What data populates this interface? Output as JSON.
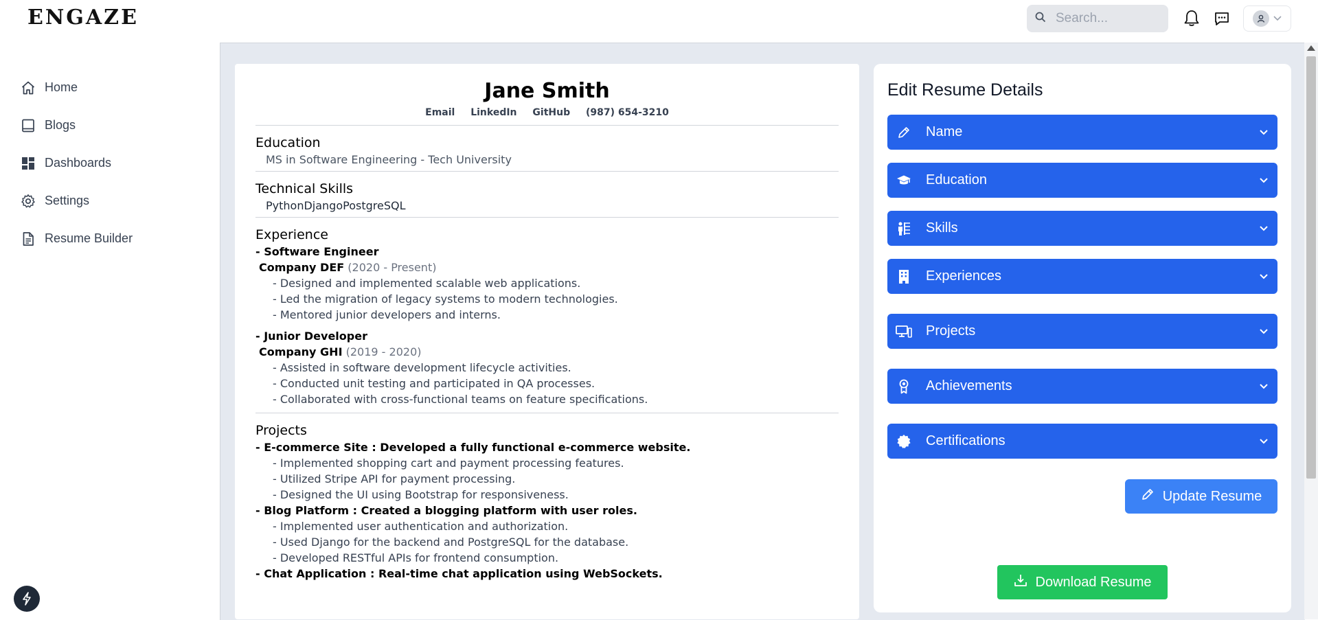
{
  "app": {
    "logo": "ENGAZE"
  },
  "header": {
    "search_placeholder": "Search..."
  },
  "sidebar": {
    "items": [
      {
        "label": "Home",
        "icon": "home-icon"
      },
      {
        "label": "Blogs",
        "icon": "book-icon"
      },
      {
        "label": "Dashboards",
        "icon": "grid-icon"
      },
      {
        "label": "Settings",
        "icon": "gear-icon"
      },
      {
        "label": "Resume Builder",
        "icon": "document-icon"
      }
    ]
  },
  "resume": {
    "name": "Jane Smith",
    "contact": {
      "email": "Email",
      "linkedin": "LinkedIn",
      "github": "GitHub",
      "phone": "(987) 654-3210"
    },
    "education": {
      "heading": "Education",
      "entry": "MS in Software Engineering - Tech University"
    },
    "skills": {
      "heading": "Technical Skills",
      "text": "PythonDjangoPostgreSQL"
    },
    "experience": {
      "heading": "Experience",
      "jobs": [
        {
          "role": "- Software Engineer",
          "company": "Company DEF",
          "years": "(2020 - Present)",
          "bullets": [
            "- Designed and implemented scalable web applications.",
            "- Led the migration of legacy systems to modern technologies.",
            "- Mentored junior developers and interns."
          ]
        },
        {
          "role": "- Junior Developer",
          "company": "Company GHI",
          "years": "(2019 - 2020)",
          "bullets": [
            "- Assisted in software development lifecycle activities.",
            "- Conducted unit testing and participated in QA processes.",
            "- Collaborated with cross-functional teams on feature specifications."
          ]
        }
      ]
    },
    "projects": {
      "heading": "Projects",
      "items": [
        {
          "title": "- E-commerce Site : Developed a fully functional e-commerce website.",
          "bullets": [
            "- Implemented shopping cart and payment processing features.",
            "- Utilized Stripe API for payment processing.",
            "- Designed the UI using Bootstrap for responsiveness."
          ]
        },
        {
          "title": "- Blog Platform : Created a blogging platform with user roles.",
          "bullets": [
            "- Implemented user authentication and authorization.",
            "- Used Django for the backend and PostgreSQL for the database.",
            "- Developed RESTful APIs for frontend consumption."
          ]
        },
        {
          "title": "- Chat Application : Real-time chat application using WebSockets.",
          "bullets": []
        }
      ]
    }
  },
  "panel": {
    "title": "Edit Resume Details",
    "sections": [
      {
        "label": "Name",
        "icon": "pencil-icon"
      },
      {
        "label": "Education",
        "icon": "graduation-cap-icon"
      },
      {
        "label": "Skills",
        "icon": "skills-icon"
      },
      {
        "label": "Experiences",
        "icon": "building-icon"
      },
      {
        "label": "Projects",
        "icon": "computer-icon"
      },
      {
        "label": "Achievements",
        "icon": "award-icon"
      },
      {
        "label": "Certifications",
        "icon": "certificate-icon"
      }
    ],
    "update_label": "Update Resume",
    "download_label": "Download Resume"
  },
  "colors": {
    "accent": "#2563eb",
    "update": "#3b82f6",
    "download": "#22c55e",
    "main_bg": "#e5e9f0"
  }
}
